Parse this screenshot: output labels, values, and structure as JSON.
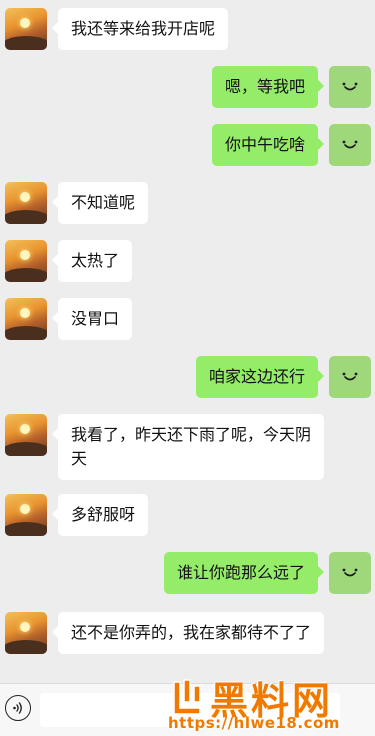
{
  "messages": [
    {
      "side": "left",
      "text": "我还等来给我开店呢"
    },
    {
      "side": "right",
      "text": "嗯，等我吧"
    },
    {
      "side": "right",
      "text": "你中午吃啥"
    },
    {
      "side": "left",
      "text": "不知道呢"
    },
    {
      "side": "left",
      "text": "太热了"
    },
    {
      "side": "left",
      "text": "没胃口"
    },
    {
      "side": "right",
      "text": "咱家这边还行"
    },
    {
      "side": "left",
      "text": "我看了，昨天还下雨了呢，今天阴天"
    },
    {
      "side": "left",
      "text": "多舒服呀"
    },
    {
      "side": "right",
      "text": "谁让你跑那么远了"
    },
    {
      "side": "left",
      "text": "还不是你弄的，我在家都待不了了"
    }
  ],
  "input": {
    "value": ""
  },
  "watermark": {
    "name": "黑料网",
    "url": "https://hlwe18.com"
  },
  "colors": {
    "background": "#ededed",
    "sent_bubble": "#95ec69",
    "received_bubble": "#ffffff",
    "watermark": "#f07a00"
  },
  "icons": {
    "voice": "voice-icon",
    "self_avatar": "smile-icon"
  }
}
